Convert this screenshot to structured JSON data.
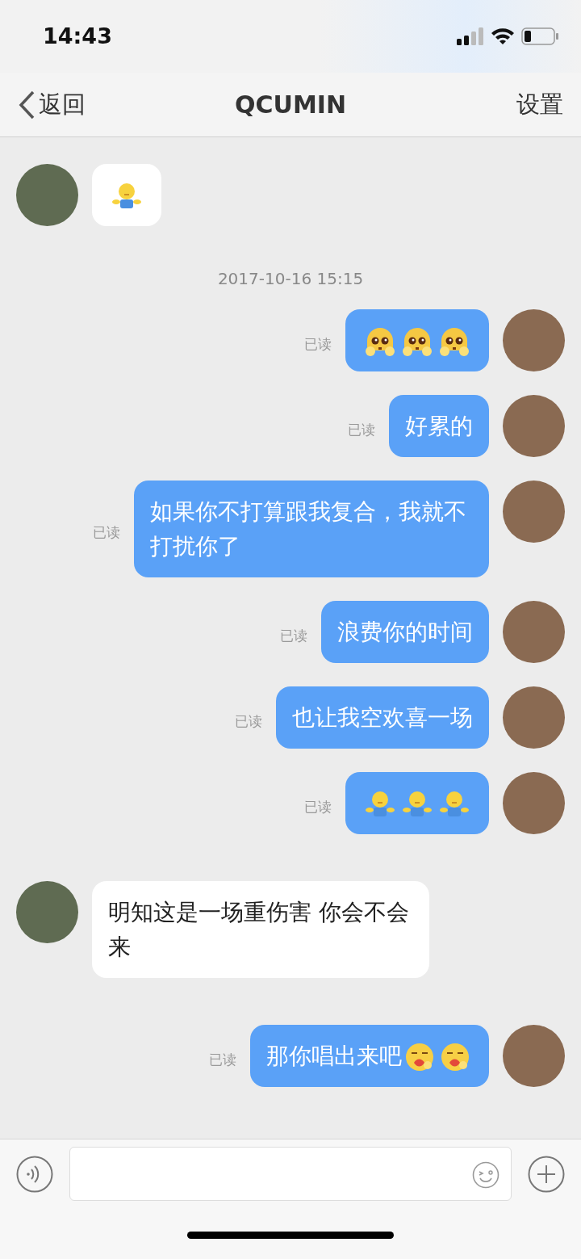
{
  "status_bar": {
    "time": "14:43"
  },
  "nav": {
    "back": "返回",
    "title": "QCUMIN",
    "action": "设置"
  },
  "messages": [
    {
      "kind": "incoming",
      "stickers": [
        {
          "kind": "hug"
        }
      ]
    },
    {
      "kind": "timestamp",
      "text": "2017-10-16 15:15"
    },
    {
      "kind": "outgoing",
      "stickers": [
        {
          "kind": "pleading"
        },
        {
          "kind": "pleading"
        },
        {
          "kind": "pleading"
        }
      ],
      "status": "已读"
    },
    {
      "kind": "outgoing",
      "text": "好累的",
      "status": "已读"
    },
    {
      "kind": "outgoing",
      "text": "如果你不打算跟我复合，我就不打扰你了",
      "status": "已读"
    },
    {
      "kind": "outgoing",
      "text": "浪费你的时间",
      "status": "已读"
    },
    {
      "kind": "outgoing",
      "text": "也让我空欢喜一场",
      "status": "已读"
    },
    {
      "kind": "outgoing",
      "stickers": [
        {
          "kind": "hug"
        },
        {
          "kind": "hug"
        },
        {
          "kind": "hug"
        }
      ],
      "status": "已读"
    },
    {
      "kind": "incoming",
      "text": "明知这是一场重伤害 你会不会来"
    },
    {
      "kind": "outgoing",
      "text": "那你唱出来吧",
      "stickers": [
        {
          "kind": "blush"
        },
        {
          "kind": "blush"
        }
      ],
      "status": "已读"
    }
  ]
}
